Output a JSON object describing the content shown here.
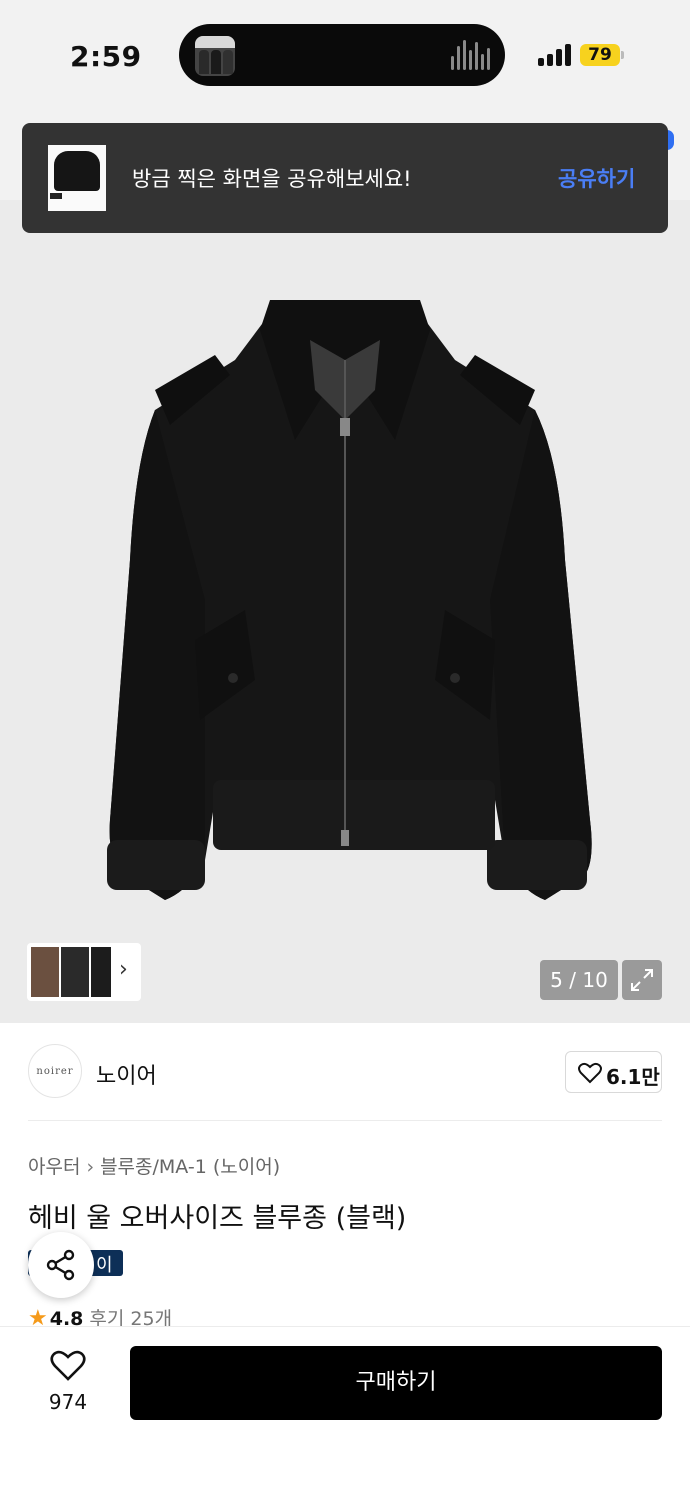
{
  "status_bar": {
    "time": "2:59",
    "battery": "79",
    "battery_color": "#f7d21e"
  },
  "toast": {
    "message": "방금 찍은 화면을 공유해보세요!",
    "action": "공유하기",
    "action_color": "#4a7ef5"
  },
  "gallery": {
    "counter": "5 / 10",
    "current": 5,
    "total": 10
  },
  "brand": {
    "logo_text": "noirer",
    "name": "노이어",
    "likes": "6.1만"
  },
  "product": {
    "breadcrumb": [
      "아우터",
      "블루종/MA-1 (노이어)"
    ],
    "title": "헤비 울 오버사이즈 블루종 (블랙)",
    "badge": "이",
    "badge_color": "#0d2f57",
    "rating": "4.8",
    "reviews": "후기 25개"
  },
  "bottom_bar": {
    "wishlist_count": "974",
    "buy_label": "구매하기"
  },
  "icons": [
    "signal-icon",
    "heart-icon",
    "share-icon",
    "expand-icon",
    "chevron-right-icon",
    "star-icon"
  ]
}
